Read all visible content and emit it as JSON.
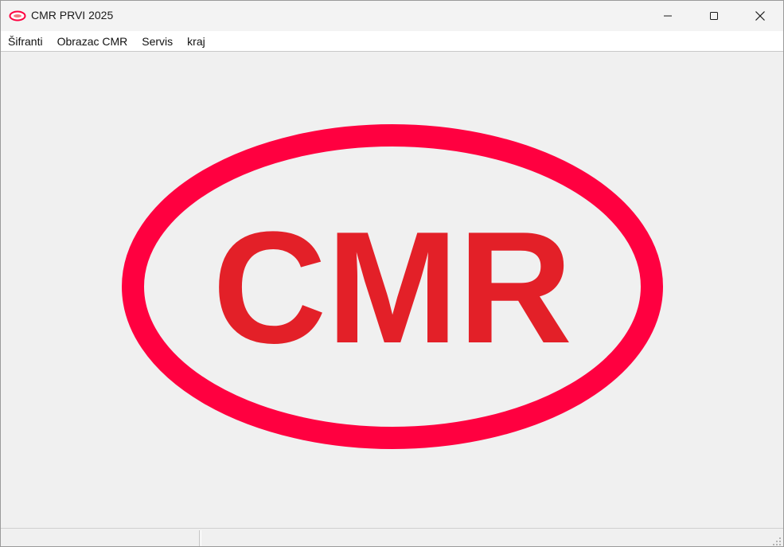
{
  "window": {
    "title": "CMR PRVI 2025",
    "icon": "cmr-logo-icon"
  },
  "controls": {
    "minimize_icon": "minimize-icon",
    "maximize_icon": "maximize-icon",
    "close_icon": "close-icon"
  },
  "menu": {
    "items": [
      "Šifranti",
      "Obrazac CMR",
      "Servis",
      "kraj"
    ]
  },
  "logo": {
    "text": "CMR",
    "oval_color": "#ff0040",
    "text_color": "#e32028"
  },
  "statusbar": {
    "panel1": "",
    "panel2": ""
  }
}
